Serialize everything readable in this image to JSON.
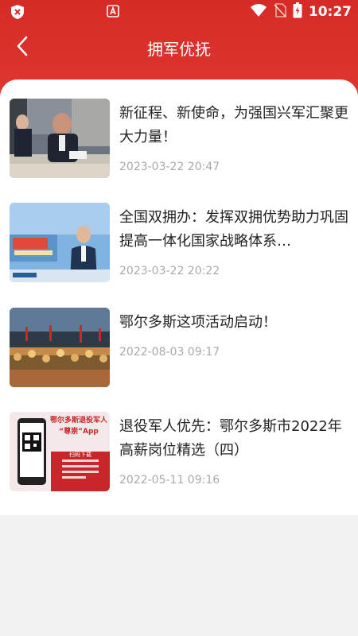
{
  "status_bar": {
    "time": "10:27",
    "icons": [
      "shield-icon",
      "app-a-icon",
      "wifi-icon",
      "no-sim-icon",
      "battery-charging-icon"
    ]
  },
  "navbar": {
    "title": "拥军优抚",
    "back_icon": "chevron-left-icon"
  },
  "colors": {
    "header": "#d62a26",
    "title_text": "#222222",
    "time_text": "#a9a9a9",
    "background": "#f2f2f2"
  },
  "news": [
    {
      "title": "新征程、新使命，为强国兴军汇聚更大力量！",
      "time": "2023-03-22 20:47",
      "image": "meeting-photo"
    },
    {
      "title": "全国双拥办：发挥双拥优势助力巩固提高一体化国家战略体系…",
      "time": "2023-03-22 20:22",
      "image": "news-anchor-photo"
    },
    {
      "title": "鄂尔多斯这项活动启动！",
      "time": "2022-08-03 09:17",
      "image": "crowd-event-photo"
    },
    {
      "title": "退役军人优先：鄂尔多斯市2022年高薪岗位精选（四）",
      "time": "2022-05-11 09:16",
      "image": "app-poster",
      "poster_text": {
        "line1": "鄂尔多斯退役军人",
        "line2": "“尊崇”App",
        "label": "扫码下载"
      }
    }
  ]
}
